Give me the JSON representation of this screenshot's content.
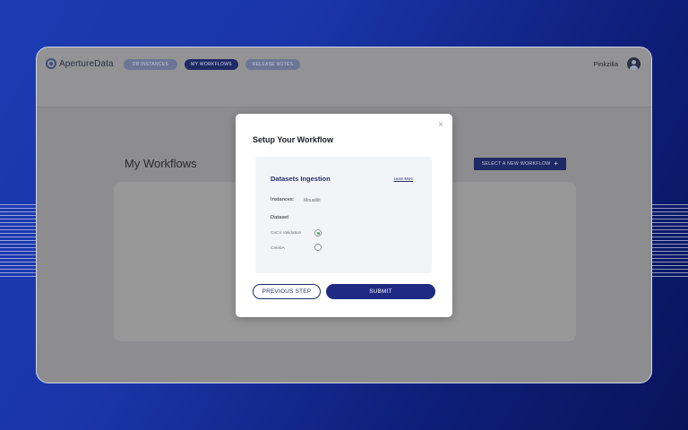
{
  "app": {
    "logo_text": "ApertureData",
    "nav": [
      {
        "label": "DB INSTANCES"
      },
      {
        "label": "MY WORKFLOWS"
      },
      {
        "label": "RELEASE NOTES"
      }
    ],
    "username": "Pinkzilla"
  },
  "page": {
    "title": "My Workflows",
    "select_button": "SELECT A NEW WORKFLOW",
    "plus_icon": "+"
  },
  "modal": {
    "title": "Setup Your Workflow",
    "close_icon": "×",
    "workflow_name": "Datasets Ingestion",
    "learn_more": "Learn More",
    "instances_label": "Instances:",
    "instances_value": "Mouatilit",
    "dataset_label": "Dataset",
    "options": [
      {
        "label": "CoCo Validation",
        "selected": true
      },
      {
        "label": "CelebA",
        "selected": false
      }
    ],
    "prev_button": "PREVIOUS STEP",
    "submit_button": "SUBMIT"
  },
  "colors": {
    "accent": "#1e2a66",
    "submit": "#1e2a84",
    "radio_selected": "#2faa4d"
  }
}
